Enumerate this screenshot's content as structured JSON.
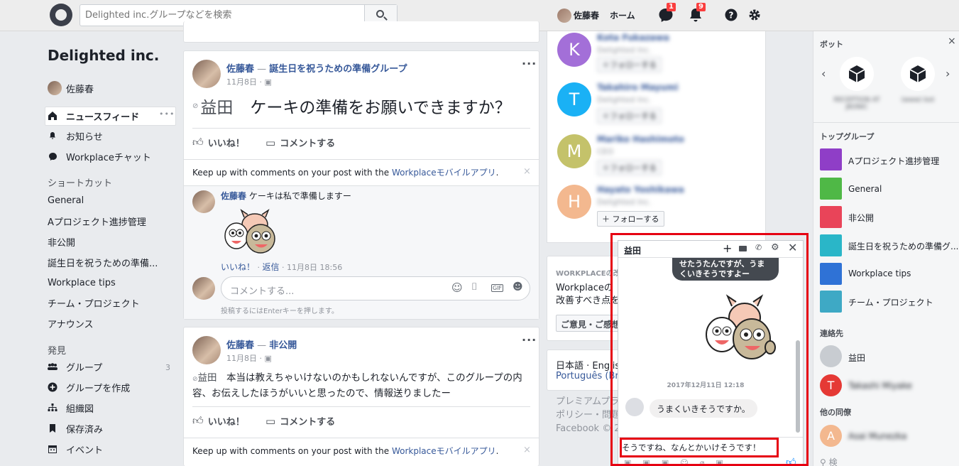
{
  "topbar": {
    "search_placeholder": "Delighted inc.グループなどを検索",
    "user_name": "佐藤春",
    "home_label": "ホーム",
    "chat_badge": "1",
    "notif_badge": "9"
  },
  "leftnav": {
    "company": "Delighted inc.",
    "profile_name": "佐藤春",
    "newsfeed": "ニュースフィード",
    "newsfeed_more": "•••",
    "notifications": "お知らせ",
    "workplace_chat": "Workplaceチャット",
    "shortcuts_title": "ショートカット",
    "shortcuts": [
      "General",
      "Aプロジェクト進捗管理",
      "非公開",
      "誕生日を祝うための準備...",
      "Workplace tips",
      "チーム・プロジェクト",
      "アナウンス"
    ],
    "discover_title": "発見",
    "groups_label": "グループ",
    "groups_count": "3",
    "create_group": "グループを作成",
    "org_chart": "組織図",
    "saved": "保存済み",
    "events": "イベント"
  },
  "post1": {
    "author": "佐藤春",
    "separator": "—",
    "group": "誕生日を祝うための準備グループ",
    "date": "11月8日 · ",
    "mention": "益田",
    "body": "ケーキの準備をお願いできますか？",
    "like": "いいね！",
    "comment": "コメントする",
    "keepup_prefix": "Keep up with comments on your post with the ",
    "keepup_link": "Workplaceモバイルアプリ",
    "keepup_suffix": ".",
    "reply_author": "佐藤春",
    "reply_text": "ケーキは私で準備しますー",
    "reply_like": "いいね！",
    "reply_dot": " · ",
    "reply_reply": "返信",
    "reply_time": " · 11月8日 18:56",
    "comment_placeholder": "コメントする...",
    "enter_hint": "投稿するにはEnterキーを押します。",
    "gif": "GIF"
  },
  "post2": {
    "author": "佐藤春",
    "separator": "—",
    "group": "非公開",
    "date": "11月8日 · ",
    "mention": "益田",
    "body": "本当は教えちゃいけないのかもしれないんですが、このグループの内容、お伝えしたほうがいいと思ったので、情報送りましたー",
    "like": "いいね！",
    "comment": "コメントする",
    "keepup_prefix": "Keep up with comments on your post with the ",
    "keepup_link": "Workplaceモバイルアプリ",
    "keepup_suffix": "."
  },
  "people": [
    {
      "initial": "K",
      "color": "#a36fd8",
      "name": "Kota Fukazawa",
      "org": "Delighted Inc.",
      "follow": "フォローする"
    },
    {
      "initial": "T",
      "color": "#1ab1f5",
      "name": "Takahiro Mayumi",
      "org": "Delighted Inc.",
      "follow": "フォローする"
    },
    {
      "initial": "M",
      "color": "#c4c26a",
      "name": "Mariko Hashimoto",
      "org": "CEO",
      "follow": "フォローする"
    },
    {
      "initial": "H",
      "color": "#f3b88f",
      "name": "Hayato Yoshikawa",
      "org": "Delighted Inc.",
      "follow": "フォローする"
    }
  ],
  "feedback": {
    "title": "WORKPLACEの改",
    "text": "Workplaceの改善すべき点を",
    "button": "ご意見・ご感想"
  },
  "languages": {
    "line1": "日本語 · Englis",
    "line2": "Português (Bra"
  },
  "footer": {
    "line1": "プレミアムプラ",
    "line2": "ポリシー・問題",
    "line3": "Facebook © 20"
  },
  "rightbar": {
    "bots_title": "ボット",
    "close": "×",
    "bots": [
      "RECEPTION AT JKONIC",
      "(www) bot"
    ],
    "top_groups_title": "トップグループ",
    "groups": [
      {
        "name": "Aプロジェクト進捗管理",
        "color": "#8f3ec7"
      },
      {
        "name": "General",
        "color": "#4fb846"
      },
      {
        "name": "非公開",
        "color": "#e94459"
      },
      {
        "name": "誕生日を祝うための準備グ...",
        "color": "#2ab6c8"
      },
      {
        "name": "Workplace tips",
        "color": "#2f72d6"
      },
      {
        "name": "チーム・プロジェクト",
        "color": "#3ea9c5"
      }
    ],
    "contacts_title": "連絡先",
    "contacts": [
      {
        "name": "益田",
        "color": "#c8ccd1"
      },
      {
        "name": "Takashi Miyake",
        "color": "#e53935",
        "initial": "T"
      }
    ],
    "others_title": "他の同僚",
    "others": [
      {
        "name": "Asai Munezka",
        "color": "#f3b88f",
        "initial": "A"
      }
    ],
    "search_placeholder": "検"
  },
  "chat": {
    "title": "益田",
    "bubble_text": "せたうたんですが、うまくいきそうですよー",
    "timestamp": "2017年12月11日 12:18",
    "incoming_text": "うまくいきそうですか。",
    "input_value": "そうですね、なんとかいけそうです！"
  }
}
